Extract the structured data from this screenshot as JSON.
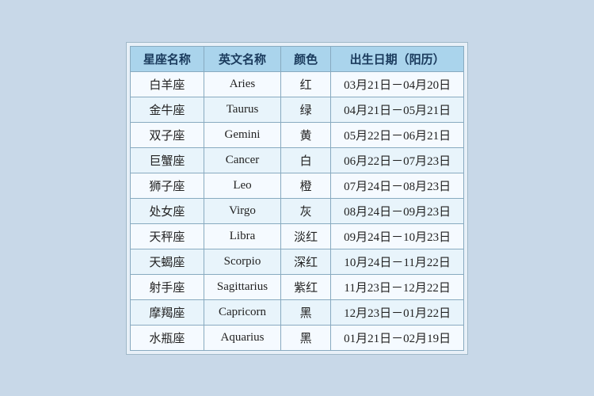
{
  "table": {
    "headers": [
      "星座名称",
      "英文名称",
      "颜色",
      "出生日期（阳历）"
    ],
    "rows": [
      {
        "chinese": "白羊座",
        "english": "Aries",
        "color": "红",
        "dates": "03月21日－04月20日"
      },
      {
        "chinese": "金牛座",
        "english": "Taurus",
        "color": "绿",
        "dates": "04月21日－05月21日"
      },
      {
        "chinese": "双子座",
        "english": "Gemini",
        "color": "黄",
        "dates": "05月22日－06月21日"
      },
      {
        "chinese": "巨蟹座",
        "english": "Cancer",
        "color": "白",
        "dates": "06月22日－07月23日"
      },
      {
        "chinese": "狮子座",
        "english": "Leo",
        "color": "橙",
        "dates": "07月24日－08月23日"
      },
      {
        "chinese": "处女座",
        "english": "Virgo",
        "color": "灰",
        "dates": "08月24日－09月23日"
      },
      {
        "chinese": "天秤座",
        "english": "Libra",
        "color": "淡红",
        "dates": "09月24日－10月23日"
      },
      {
        "chinese": "天蝎座",
        "english": "Scorpio",
        "color": "深红",
        "dates": "10月24日－11月22日"
      },
      {
        "chinese": "射手座",
        "english": "Sagittarius",
        "color": "紫红",
        "dates": "11月23日－12月22日"
      },
      {
        "chinese": "摩羯座",
        "english": "Capricorn",
        "color": "黑",
        "dates": "12月23日－01月22日"
      },
      {
        "chinese": "水瓶座",
        "english": "Aquarius",
        "color": "黑",
        "dates": "01月21日－02月19日"
      }
    ]
  }
}
